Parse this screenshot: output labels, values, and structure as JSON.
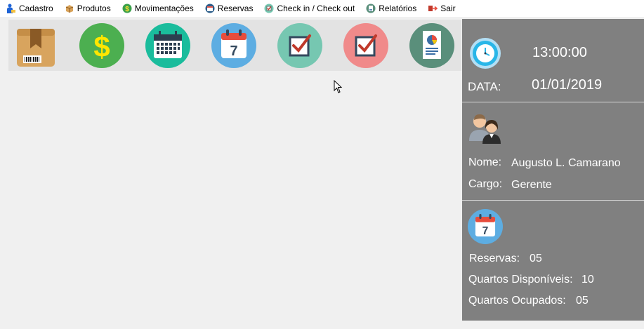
{
  "menu": {
    "items": [
      {
        "label": "Cadastro",
        "icon": "person-icon"
      },
      {
        "label": "Produtos",
        "icon": "box-icon"
      },
      {
        "label": "Movimentações",
        "icon": "dollar-icon"
      },
      {
        "label": "Reservas",
        "icon": "reservation-icon"
      },
      {
        "label": "Check in / Check out",
        "icon": "check-icon"
      },
      {
        "label": "Relatórios",
        "icon": "report-icon"
      },
      {
        "label": "Sair",
        "icon": "exit-icon"
      }
    ]
  },
  "toolbar": {
    "buttons": [
      {
        "icon": "package-icon"
      },
      {
        "icon": "dollar-icon"
      },
      {
        "icon": "calendar-grid-icon"
      },
      {
        "icon": "calendar-7-icon"
      },
      {
        "icon": "checkin-icon"
      },
      {
        "icon": "checkout-icon"
      },
      {
        "icon": "report-icon"
      }
    ]
  },
  "panel": {
    "time": "13:00:00",
    "date_label": "DATA:",
    "date": "01/01/2019",
    "user": {
      "name_label": "Nome:",
      "name": "Augusto L. Camarano",
      "role_label": "Cargo:",
      "role": "Gerente"
    },
    "stats": {
      "reservas_label": "Reservas:",
      "reservas": "05",
      "disponiveis_label": "Quartos Disponíveis:",
      "disponiveis": "10",
      "ocupados_label": "Quartos Ocupados:",
      "ocupados": "05"
    }
  },
  "colors": {
    "panel_bg": "#808080",
    "toolbar_bg": "#e3e3e3",
    "dollar_green": "#4caf50",
    "calendar_teal": "#1abc9c",
    "calendar_blue": "#5dade2",
    "checkin_green": "#76c7b1",
    "checkout_red": "#f08a8a",
    "report_green": "#5a8f7b"
  }
}
